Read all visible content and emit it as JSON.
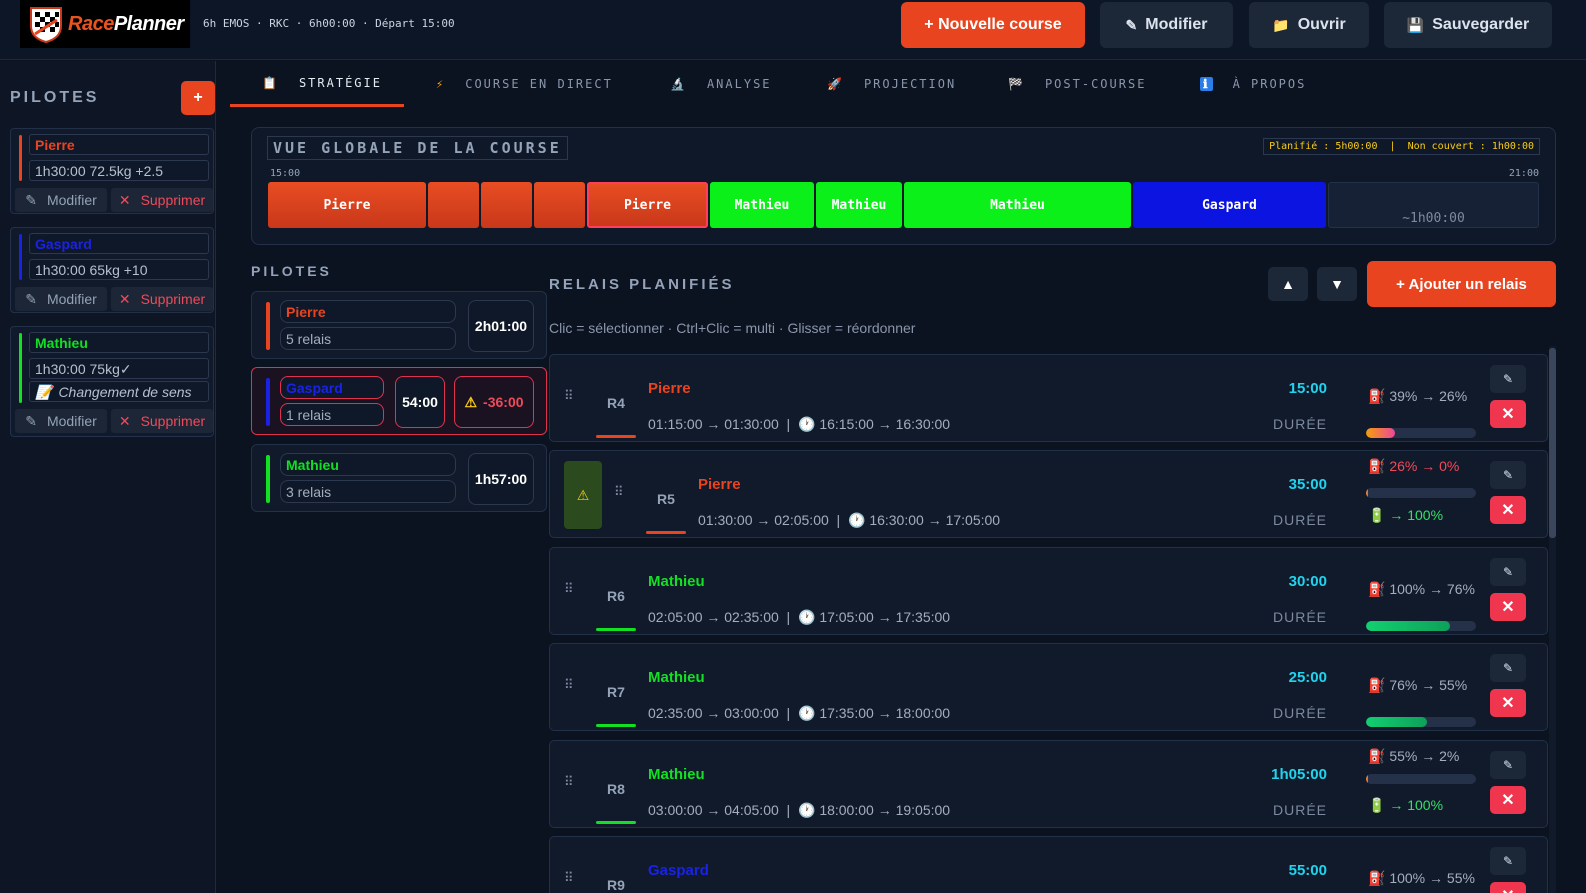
{
  "header": {
    "logo_race": "Race",
    "logo_planner": "Planner",
    "race_info": "6h EMOS · RKC · 6h00:00 · Départ 15:00",
    "buttons": {
      "new_race": "+ Nouvelle course",
      "edit": "Modifier",
      "open": "Ouvrir",
      "save": "Sauvegarder"
    }
  },
  "sidebar": {
    "title": "PILOTES",
    "add": "+",
    "edit_label": "Modifier",
    "delete_label": "Supprimer",
    "pilots": [
      {
        "name": "Pierre",
        "info": "1h30:00  72.5kg +2.5",
        "color": "#e8441f"
      },
      {
        "name": "Gaspard",
        "info": "1h30:00  65kg +10",
        "color": "#1a22e6"
      },
      {
        "name": "Mathieu",
        "info": "1h30:00  75kg✓",
        "note": "Changement de sens",
        "color": "#12e022"
      }
    ]
  },
  "tabs": [
    {
      "icon": "📋",
      "label": "STRATÉGIE"
    },
    {
      "icon": "⚡",
      "label": "COURSE EN DIRECT"
    },
    {
      "icon": "🔬",
      "label": "ANALYSE"
    },
    {
      "icon": "🚀",
      "label": "PROJECTION"
    },
    {
      "icon": "🏁",
      "label": "POST-COURSE"
    },
    {
      "icon": "ℹ",
      "label": "À PROPOS"
    }
  ],
  "overview": {
    "title": "VUE GLOBALE DE LA COURSE",
    "status": "Planifié : 5h00:00  |  Non couvert : 1h00:00",
    "start": "15:00",
    "end": "21:00",
    "segments": [
      "Pierre",
      "",
      "",
      "",
      "Pierre",
      "Mathieu",
      "Mathieu",
      "Mathieu",
      "Gaspard",
      "~1h00:00"
    ]
  },
  "pilot_stats": {
    "title": "PILOTES",
    "items": [
      {
        "name": "Pierre",
        "relays": "5 relais",
        "time": "2h01:00"
      },
      {
        "name": "Gaspard",
        "relays": "1 relais",
        "time": "54:00",
        "delta": "-36:00"
      },
      {
        "name": "Mathieu",
        "relays": "3 relais",
        "time": "1h57:00"
      }
    ]
  },
  "relays_panel": {
    "title": "RELAIS PLANIFIÉS",
    "hint": "Clic = sélectionner · Ctrl+Clic = multi · Glisser = réordonner",
    "up": "▲",
    "down": "▼",
    "add": "+ Ajouter un relais",
    "duration_label": "DURÉE",
    "relays": [
      {
        "id": "R4",
        "pilot": "Pierre",
        "times": "01:15:00 → 01:30:00",
        "clock": "16:15:00 → 16:30:00",
        "duration": "15:00",
        "fuel": "39% → 26%",
        "fuel_level": 0.26
      },
      {
        "id": "R5",
        "pilot": "Pierre",
        "times": "01:30:00 → 02:05:00",
        "clock": "16:30:00 → 17:05:00",
        "duration": "35:00",
        "fuel": "26% → 0%",
        "fuel_level": 0,
        "refuel": "→ 100%"
      },
      {
        "id": "R6",
        "pilot": "Mathieu",
        "times": "02:05:00 → 02:35:00",
        "clock": "17:05:00 → 17:35:00",
        "duration": "30:00",
        "fuel": "100% → 76%",
        "fuel_level": 0.76
      },
      {
        "id": "R7",
        "pilot": "Mathieu",
        "times": "02:35:00 → 03:00:00",
        "clock": "17:35:00 → 18:00:00",
        "duration": "25:00",
        "fuel": "76% → 55%",
        "fuel_level": 0.55
      },
      {
        "id": "R8",
        "pilot": "Mathieu",
        "times": "03:00:00 → 04:05:00",
        "clock": "18:00:00 → 19:05:00",
        "duration": "1h05:00",
        "fuel": "55% → 2%",
        "fuel_level": 0.02,
        "refuel": "→ 100%"
      },
      {
        "id": "R9",
        "pilot": "Gaspard",
        "times": "",
        "clock": "",
        "duration": "55:00",
        "fuel": "100% → 55%",
        "fuel_level": 0.55
      }
    ]
  },
  "colors": {
    "accent": "#e8441f",
    "pierre": "#e8441f",
    "gaspard": "#1a22e6",
    "mathieu": "#12e022",
    "duration": "#22d3ee",
    "danger": "#f0364f"
  }
}
